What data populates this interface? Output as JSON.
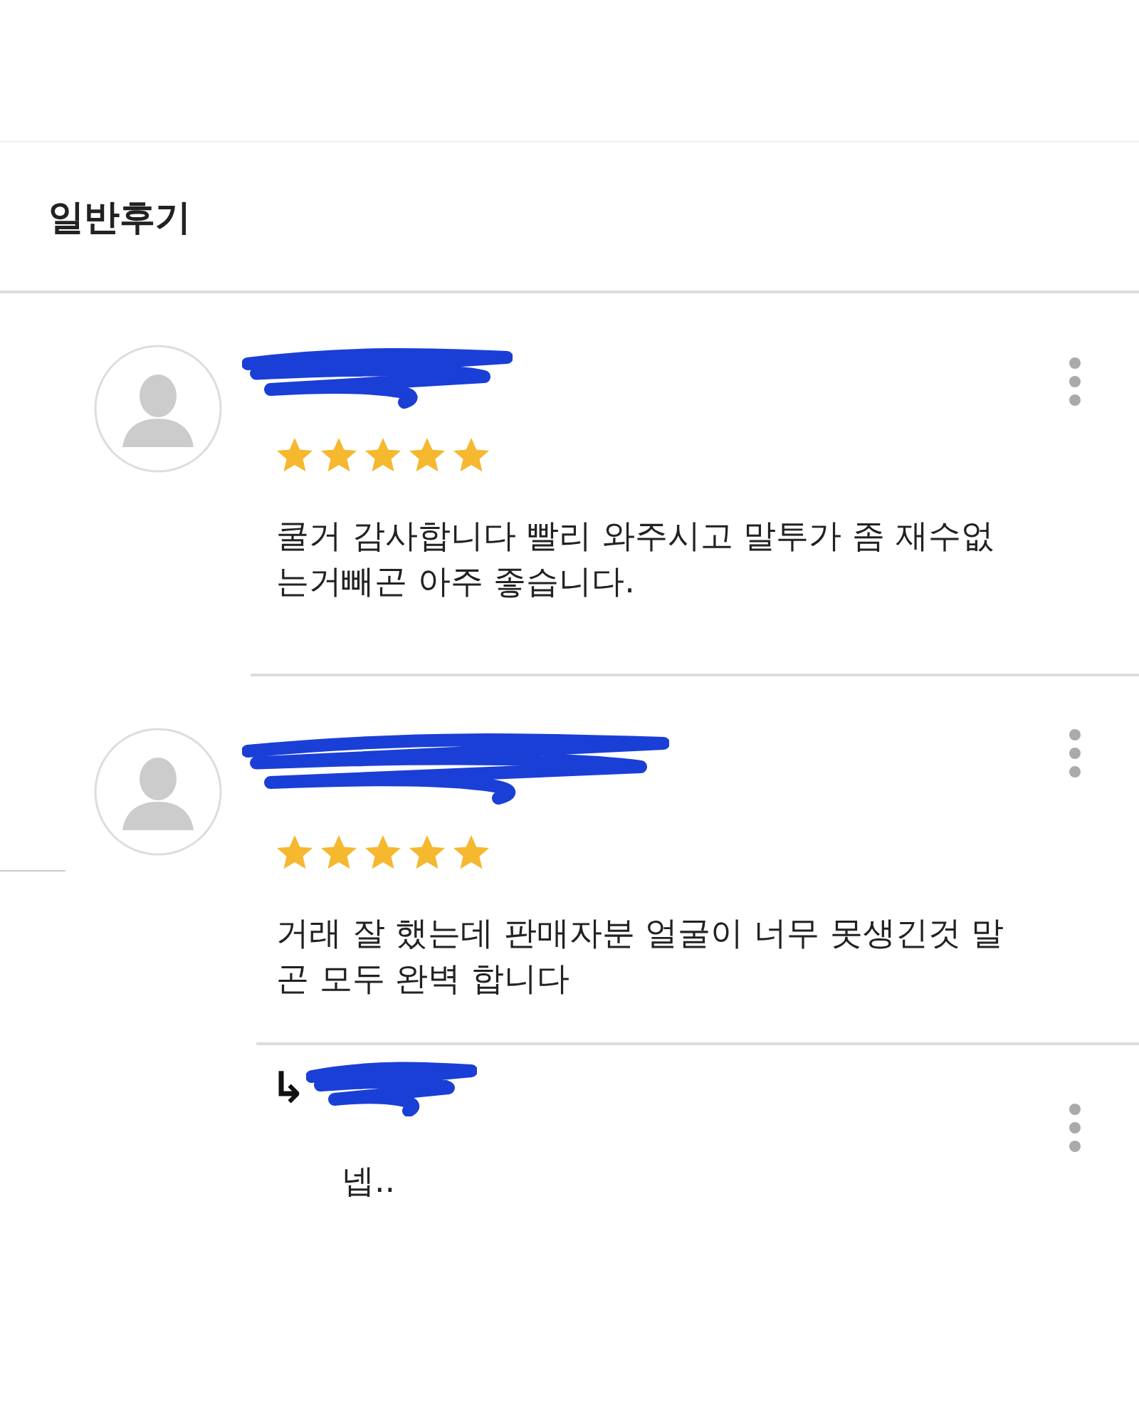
{
  "section_title": "일반후기",
  "reviews": [
    {
      "stars": 5,
      "text": "쿨거 감사합니다 빨리 와주시고 말투가 좀 재수없는거빼곤 아주 좋습니다."
    },
    {
      "stars": 5,
      "text": "거래 잘 했는데 판매자분 얼굴이 너무 못생긴것 말곤 모두 완벽 합니다",
      "replies": [
        {
          "arrow": "↳",
          "text": "넵.."
        }
      ]
    }
  ]
}
